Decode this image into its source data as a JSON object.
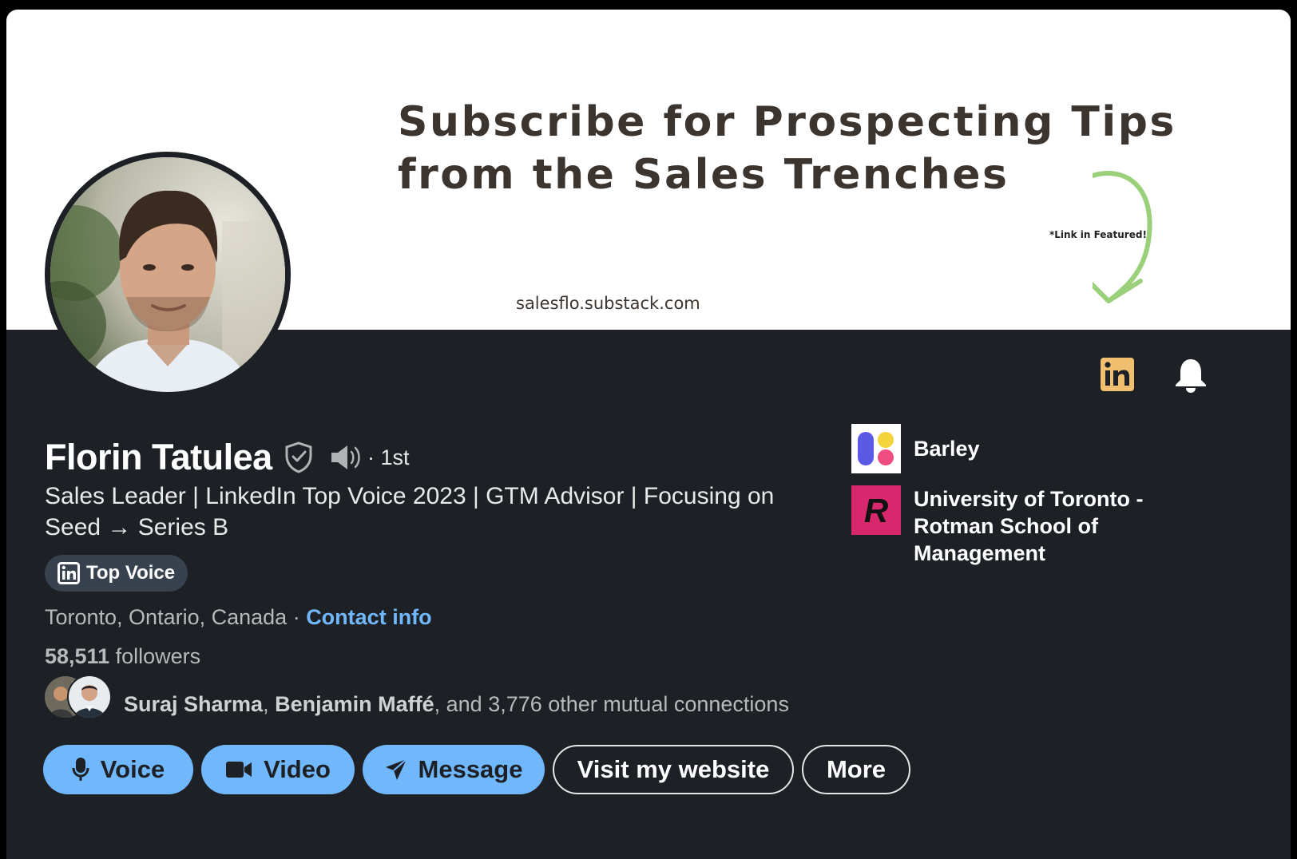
{
  "banner": {
    "headline_line1": "Subscribe for Prospecting Tips",
    "headline_line2": "from the Sales Trenches",
    "note": "*Link in Featured!",
    "url": "salesflo.substack.com"
  },
  "profile": {
    "name": "Florin Tatulea",
    "degree": "· 1st",
    "headline": "Sales Leader | LinkedIn Top Voice 2023 | GTM Advisor | Focusing on Seed → Series B",
    "badge_label": "Top Voice",
    "location": "Toronto, Ontario, Canada",
    "location_separator": " · ",
    "contact_info_label": "Contact info",
    "followers_count": "58,511",
    "followers_label": " followers",
    "mutual": {
      "name1": "Suraj Sharma",
      "separator": ", ",
      "name2": "Benjamin Maffé",
      "rest": ", and 3,776 other mutual connections"
    }
  },
  "actions": {
    "voice_label": "Voice",
    "video_label": "Video",
    "message_label": "Message",
    "website_label": "Visit my website",
    "more_label": "More"
  },
  "orgs": [
    {
      "name": "Barley",
      "icon": "barley-logo"
    },
    {
      "name": "University of Toronto - Rotman School of Management",
      "icon": "rotman-logo"
    }
  ],
  "icons": {
    "linkedin": "linkedin-icon",
    "bell": "bell-icon",
    "verified": "shield-check-icon",
    "pronunciation": "speaker-icon"
  },
  "colors": {
    "accent": "#71b7fb",
    "background": "#1d2126",
    "badge_bg": "#38424e",
    "linkedin_tile": "#f0c070",
    "rotman": "#d7286e"
  }
}
